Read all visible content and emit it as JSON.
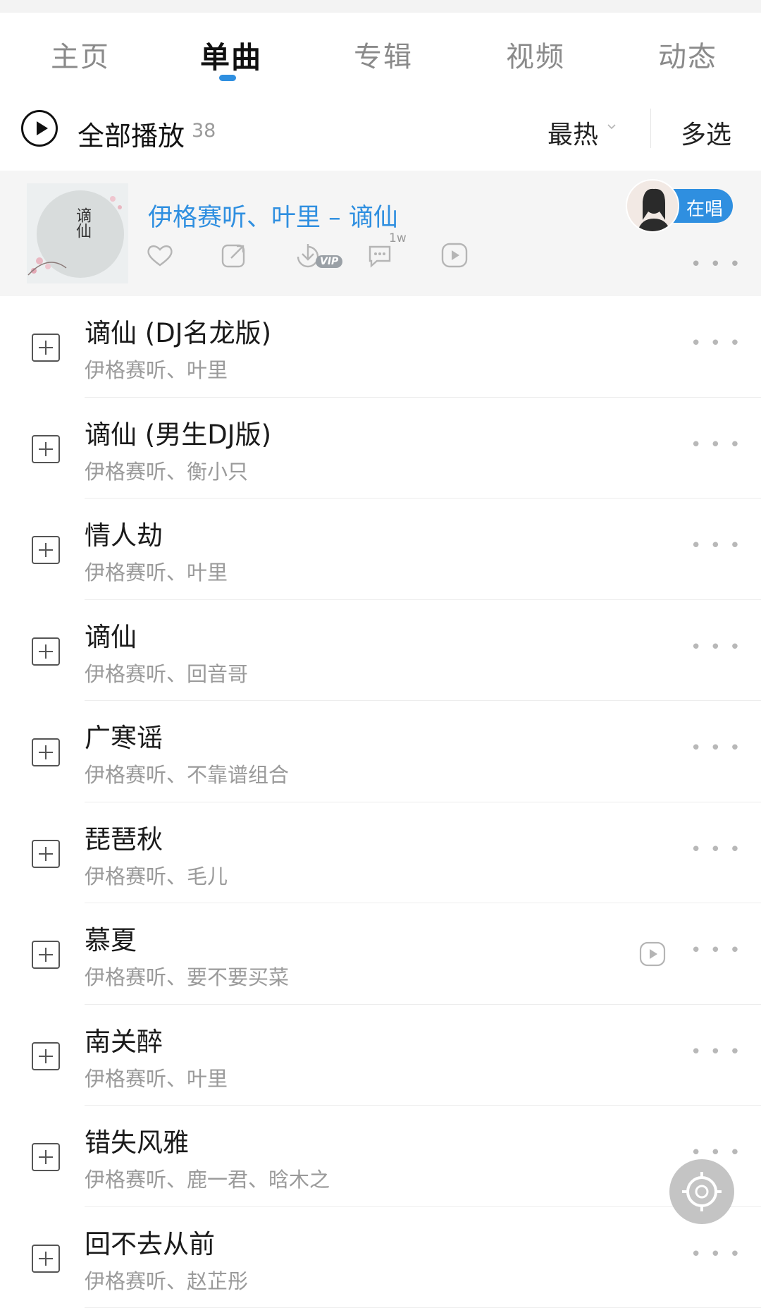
{
  "tabs": [
    {
      "label": "主页",
      "active": false
    },
    {
      "label": "单曲",
      "active": true
    },
    {
      "label": "专辑",
      "active": false
    },
    {
      "label": "视频",
      "active": false
    },
    {
      "label": "动态",
      "active": false
    }
  ],
  "toolbar": {
    "play_all_label": "全部播放",
    "count": "38",
    "sort_label": "最热",
    "multi_select_label": "多选"
  },
  "featured": {
    "cover_text": "谪仙",
    "title": "伊格赛听、叶里 – 谪仙",
    "comment_count": "1w",
    "vip_label": "VIP",
    "singing_label": "在唱"
  },
  "songs": [
    {
      "title": "谪仙 (DJ名龙版)",
      "artists": "伊格赛听、叶里",
      "has_mv": false
    },
    {
      "title": "谪仙 (男生DJ版)",
      "artists": "伊格赛听、衡小只",
      "has_mv": false
    },
    {
      "title": "情人劫",
      "artists": "伊格赛听、叶里",
      "has_mv": false
    },
    {
      "title": "谪仙",
      "artists": "伊格赛听、回音哥",
      "has_mv": false
    },
    {
      "title": "广寒谣",
      "artists": "伊格赛听、不靠谱组合",
      "has_mv": false
    },
    {
      "title": "琵琶秋",
      "artists": "伊格赛听、毛儿",
      "has_mv": false
    },
    {
      "title": "慕夏",
      "artists": "伊格赛听、要不要买菜",
      "has_mv": true
    },
    {
      "title": "南关醉",
      "artists": "伊格赛听、叶里",
      "has_mv": false
    },
    {
      "title": "错失风雅",
      "artists": "伊格赛听、鹿一君、晗木之",
      "has_mv": false
    },
    {
      "title": "回不去从前",
      "artists": "伊格赛听、赵芷彤",
      "has_mv": false
    }
  ],
  "colors": {
    "accent": "#2f8fe0",
    "secondary_text": "#9a9a9a",
    "background": "#ffffff",
    "featured_background": "#f5f5f5"
  },
  "icons": {
    "play_all": "play-circle-icon",
    "like": "heart-icon",
    "share": "share-icon",
    "download": "download-icon",
    "comment": "comment-icon",
    "mv": "video-play-icon",
    "more": "more-dots-icon",
    "add": "add-square-icon",
    "floating": "locate-icon"
  }
}
